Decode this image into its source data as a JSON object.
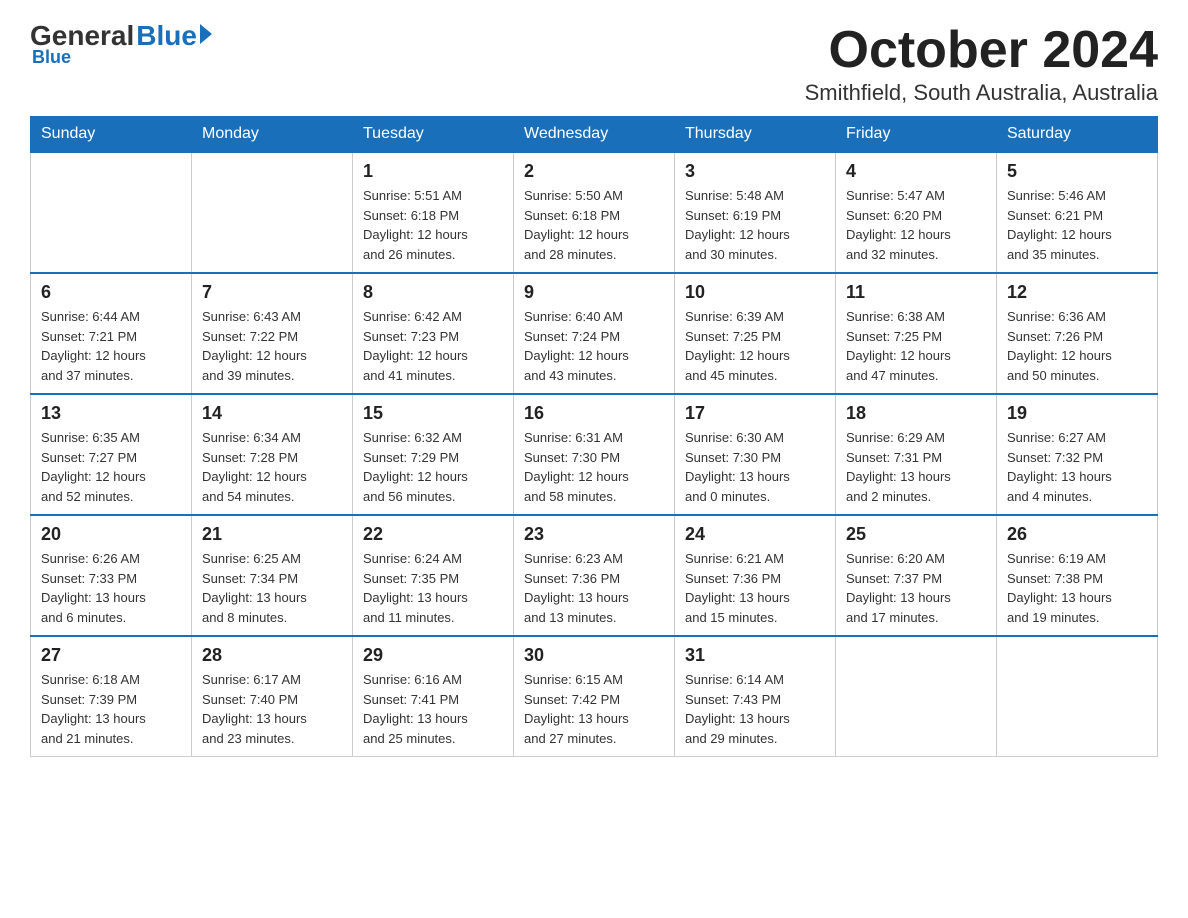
{
  "logo": {
    "general": "General",
    "blue": "Blue"
  },
  "header": {
    "month": "October 2024",
    "location": "Smithfield, South Australia, Australia"
  },
  "days_of_week": [
    "Sunday",
    "Monday",
    "Tuesday",
    "Wednesday",
    "Thursday",
    "Friday",
    "Saturday"
  ],
  "weeks": [
    [
      {
        "day": "",
        "info": ""
      },
      {
        "day": "",
        "info": ""
      },
      {
        "day": "1",
        "info": "Sunrise: 5:51 AM\nSunset: 6:18 PM\nDaylight: 12 hours\nand 26 minutes."
      },
      {
        "day": "2",
        "info": "Sunrise: 5:50 AM\nSunset: 6:18 PM\nDaylight: 12 hours\nand 28 minutes."
      },
      {
        "day": "3",
        "info": "Sunrise: 5:48 AM\nSunset: 6:19 PM\nDaylight: 12 hours\nand 30 minutes."
      },
      {
        "day": "4",
        "info": "Sunrise: 5:47 AM\nSunset: 6:20 PM\nDaylight: 12 hours\nand 32 minutes."
      },
      {
        "day": "5",
        "info": "Sunrise: 5:46 AM\nSunset: 6:21 PM\nDaylight: 12 hours\nand 35 minutes."
      }
    ],
    [
      {
        "day": "6",
        "info": "Sunrise: 6:44 AM\nSunset: 7:21 PM\nDaylight: 12 hours\nand 37 minutes."
      },
      {
        "day": "7",
        "info": "Sunrise: 6:43 AM\nSunset: 7:22 PM\nDaylight: 12 hours\nand 39 minutes."
      },
      {
        "day": "8",
        "info": "Sunrise: 6:42 AM\nSunset: 7:23 PM\nDaylight: 12 hours\nand 41 minutes."
      },
      {
        "day": "9",
        "info": "Sunrise: 6:40 AM\nSunset: 7:24 PM\nDaylight: 12 hours\nand 43 minutes."
      },
      {
        "day": "10",
        "info": "Sunrise: 6:39 AM\nSunset: 7:25 PM\nDaylight: 12 hours\nand 45 minutes."
      },
      {
        "day": "11",
        "info": "Sunrise: 6:38 AM\nSunset: 7:25 PM\nDaylight: 12 hours\nand 47 minutes."
      },
      {
        "day": "12",
        "info": "Sunrise: 6:36 AM\nSunset: 7:26 PM\nDaylight: 12 hours\nand 50 minutes."
      }
    ],
    [
      {
        "day": "13",
        "info": "Sunrise: 6:35 AM\nSunset: 7:27 PM\nDaylight: 12 hours\nand 52 minutes."
      },
      {
        "day": "14",
        "info": "Sunrise: 6:34 AM\nSunset: 7:28 PM\nDaylight: 12 hours\nand 54 minutes."
      },
      {
        "day": "15",
        "info": "Sunrise: 6:32 AM\nSunset: 7:29 PM\nDaylight: 12 hours\nand 56 minutes."
      },
      {
        "day": "16",
        "info": "Sunrise: 6:31 AM\nSunset: 7:30 PM\nDaylight: 12 hours\nand 58 minutes."
      },
      {
        "day": "17",
        "info": "Sunrise: 6:30 AM\nSunset: 7:30 PM\nDaylight: 13 hours\nand 0 minutes."
      },
      {
        "day": "18",
        "info": "Sunrise: 6:29 AM\nSunset: 7:31 PM\nDaylight: 13 hours\nand 2 minutes."
      },
      {
        "day": "19",
        "info": "Sunrise: 6:27 AM\nSunset: 7:32 PM\nDaylight: 13 hours\nand 4 minutes."
      }
    ],
    [
      {
        "day": "20",
        "info": "Sunrise: 6:26 AM\nSunset: 7:33 PM\nDaylight: 13 hours\nand 6 minutes."
      },
      {
        "day": "21",
        "info": "Sunrise: 6:25 AM\nSunset: 7:34 PM\nDaylight: 13 hours\nand 8 minutes."
      },
      {
        "day": "22",
        "info": "Sunrise: 6:24 AM\nSunset: 7:35 PM\nDaylight: 13 hours\nand 11 minutes."
      },
      {
        "day": "23",
        "info": "Sunrise: 6:23 AM\nSunset: 7:36 PM\nDaylight: 13 hours\nand 13 minutes."
      },
      {
        "day": "24",
        "info": "Sunrise: 6:21 AM\nSunset: 7:36 PM\nDaylight: 13 hours\nand 15 minutes."
      },
      {
        "day": "25",
        "info": "Sunrise: 6:20 AM\nSunset: 7:37 PM\nDaylight: 13 hours\nand 17 minutes."
      },
      {
        "day": "26",
        "info": "Sunrise: 6:19 AM\nSunset: 7:38 PM\nDaylight: 13 hours\nand 19 minutes."
      }
    ],
    [
      {
        "day": "27",
        "info": "Sunrise: 6:18 AM\nSunset: 7:39 PM\nDaylight: 13 hours\nand 21 minutes."
      },
      {
        "day": "28",
        "info": "Sunrise: 6:17 AM\nSunset: 7:40 PM\nDaylight: 13 hours\nand 23 minutes."
      },
      {
        "day": "29",
        "info": "Sunrise: 6:16 AM\nSunset: 7:41 PM\nDaylight: 13 hours\nand 25 minutes."
      },
      {
        "day": "30",
        "info": "Sunrise: 6:15 AM\nSunset: 7:42 PM\nDaylight: 13 hours\nand 27 minutes."
      },
      {
        "day": "31",
        "info": "Sunrise: 6:14 AM\nSunset: 7:43 PM\nDaylight: 13 hours\nand 29 minutes."
      },
      {
        "day": "",
        "info": ""
      },
      {
        "day": "",
        "info": ""
      }
    ]
  ]
}
